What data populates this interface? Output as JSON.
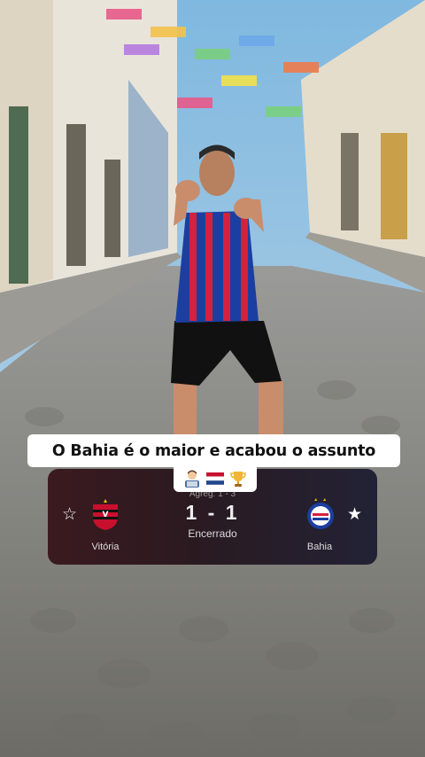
{
  "caption": {
    "text": "O Bahia é o maior e acabou o assunto",
    "emojis": [
      "man-technologist-emoji",
      "netherlands-flag-emoji",
      "trophy-emoji"
    ]
  },
  "match": {
    "aggregate": "Agreg: 1 - 3",
    "score": "1 - 1",
    "status": "Encerrado",
    "home_team": "Vitória",
    "away_team": "Bahia",
    "home_favorite": "☆",
    "away_favorite": "★"
  },
  "colors": {
    "bahia_blue": "#1b3fa0",
    "bahia_red": "#d4213d",
    "vitoria_red": "#c8102e"
  }
}
